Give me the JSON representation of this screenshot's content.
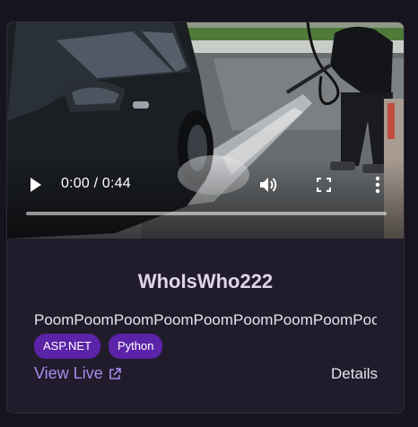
{
  "video": {
    "time_display": "0:00 / 0:44",
    "progress": 0.0,
    "icons": [
      "play-icon",
      "volume-icon",
      "fullscreen-icon",
      "more-vertical-icon"
    ]
  },
  "project": {
    "title": "WhoIsWho222",
    "description": "PoomPoomPoomPoomPoomPoomPoomPoomPoomPoom",
    "tags": [
      "ASP.NET",
      "Python"
    ],
    "view_live_label": "View Live",
    "details_label": "Details"
  },
  "colors": {
    "page_bg": "#17131f",
    "card_bg": "#211c2b",
    "tag_bg": "#5b23a8",
    "link": "#a78bf0"
  }
}
